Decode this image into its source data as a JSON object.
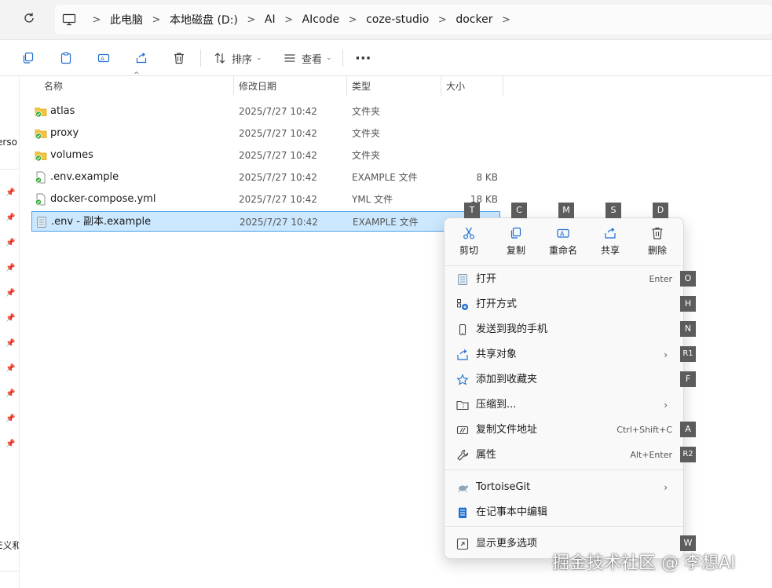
{
  "address": {
    "crumbs": [
      "此电脑",
      "本地磁盘 (D:)",
      "AI",
      "AIcode",
      "coze-studio",
      "docker"
    ]
  },
  "toolbar": {
    "sort_label": "排序",
    "view_label": "查看",
    "more_label": "···"
  },
  "left_strip": {
    "text_top": "erso",
    "text_bottom": "E义和"
  },
  "columns": {
    "name": "名称",
    "date": "修改日期",
    "type": "类型",
    "size": "大小"
  },
  "files": [
    {
      "name": "atlas",
      "date": "2025/7/27 10:42",
      "type": "文件夹",
      "size": "",
      "icon": "folder-icon",
      "selected": false
    },
    {
      "name": "proxy",
      "date": "2025/7/27 10:42",
      "type": "文件夹",
      "size": "",
      "icon": "folder-icon",
      "selected": false
    },
    {
      "name": "volumes",
      "date": "2025/7/27 10:42",
      "type": "文件夹",
      "size": "",
      "icon": "folder-icon",
      "selected": false
    },
    {
      "name": ".env.example",
      "date": "2025/7/27 10:42",
      "type": "EXAMPLE 文件",
      "size": "8 KB",
      "icon": "file-icon",
      "selected": false
    },
    {
      "name": "docker-compose.yml",
      "date": "2025/7/27 10:42",
      "type": "YML 文件",
      "size": "18 KB",
      "icon": "file-icon",
      "selected": false
    },
    {
      "name": ".env - 副本.example",
      "date": "2025/7/27 10:42",
      "type": "EXAMPLE 文件",
      "size": "",
      "icon": "file-icon",
      "selected": true
    }
  ],
  "context_menu": {
    "quick_actions": [
      {
        "label": "剪切",
        "key": "T",
        "icon": "scissors-icon"
      },
      {
        "label": "复制",
        "key": "C",
        "icon": "copy-icon"
      },
      {
        "label": "重命名",
        "key": "M",
        "icon": "rename-icon"
      },
      {
        "label": "共享",
        "key": "S",
        "icon": "share-icon"
      },
      {
        "label": "删除",
        "key": "D",
        "icon": "trash-icon"
      }
    ],
    "items": [
      {
        "label": "打开",
        "shortcut": "Enter",
        "key": "O",
        "icon": "notepad-icon"
      },
      {
        "label": "打开方式",
        "shortcut": "",
        "key": "H",
        "icon": "open-with-icon"
      },
      {
        "label": "发送到我的手机",
        "shortcut": "",
        "key": "N",
        "icon": "phone-icon"
      },
      {
        "label": "共享对象",
        "shortcut": "",
        "key": "R1",
        "icon": "share-icon",
        "submenu": true
      },
      {
        "label": "添加到收藏夹",
        "shortcut": "",
        "key": "F",
        "icon": "star-icon"
      },
      {
        "label": "压缩到...",
        "shortcut": "",
        "key": "",
        "icon": "archive-icon",
        "submenu": true
      },
      {
        "label": "复制文件地址",
        "shortcut": "Ctrl+Shift+C",
        "key": "A",
        "icon": "path-icon"
      },
      {
        "label": "属性",
        "shortcut": "Alt+Enter",
        "key": "R2",
        "icon": "wrench-icon"
      },
      {
        "label": "TortoiseGit",
        "shortcut": "",
        "key": "",
        "icon": "tortoisegit-icon",
        "submenu": true
      },
      {
        "label": "在记事本中编辑",
        "shortcut": "",
        "key": "",
        "icon": "notepad-edit-icon"
      },
      {
        "label": "显示更多选项",
        "shortcut": "",
        "key": "W",
        "icon": "more-options-icon"
      }
    ]
  },
  "watermark": "掘金技术社区 @ 李想AI",
  "colors": {
    "selection_bg": "#cce8ff",
    "selection_border": "#4a9ee8",
    "folder": "#f4c542",
    "badge_green": "#3aa83a",
    "key_bg": "#5c5c5c",
    "accent_blue": "#1f6fd1"
  }
}
